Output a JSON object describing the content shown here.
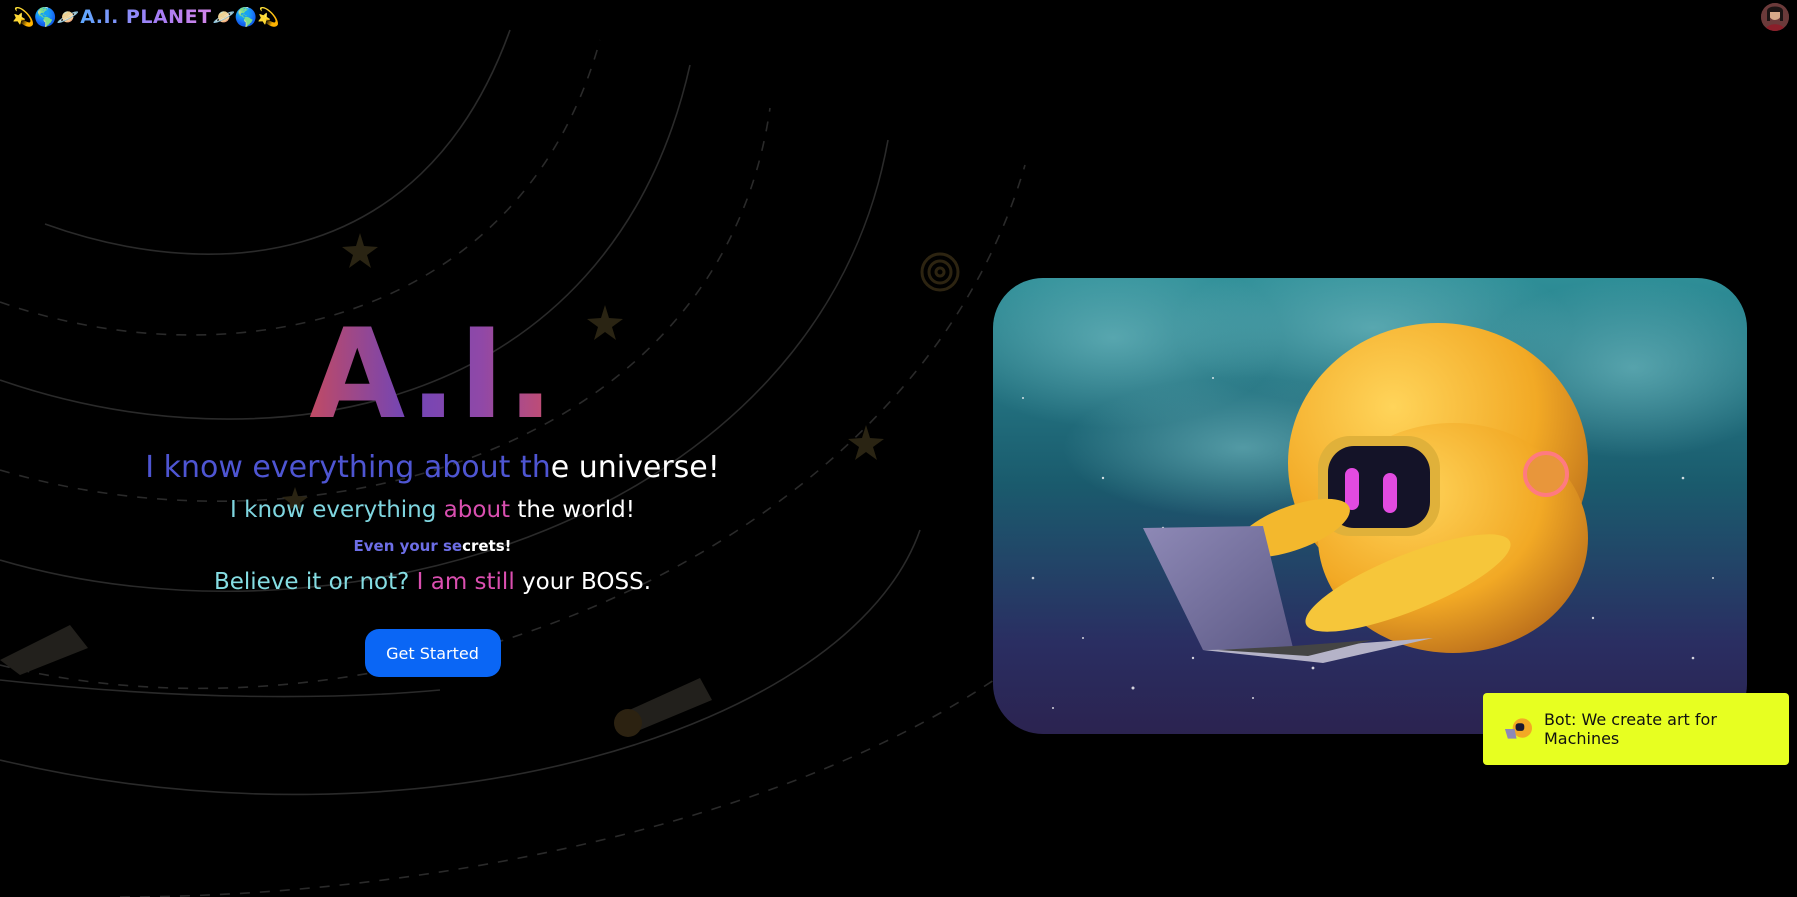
{
  "header": {
    "brand_prefix": "💫🌎🪐",
    "brand_name": "A.I. PLANET",
    "brand_suffix": "🪐🌎💫"
  },
  "hero": {
    "title": "A.I.",
    "line1_highlight": "I know everything about th",
    "line1_rest": "e universe!",
    "line2_a": "I know everything",
    "line2_b": "about",
    "line2_c": "the world!",
    "line3_a": "Even your se",
    "line3_b": "crets!",
    "line4_a": "Believe it or not?",
    "line4_b": "I am still",
    "line4_c": "your BOSS.",
    "cta_label": "Get Started"
  },
  "bot": {
    "message": "Bot: We create art for Machines"
  },
  "colors": {
    "accent_blue": "#0a66f5",
    "toast_yellow": "#e7ff21",
    "robot_orange": "#f2a925"
  },
  "icons": {
    "brand_emojis": "sparkle-globe-planet",
    "bot": "robot-with-laptop-icon"
  }
}
